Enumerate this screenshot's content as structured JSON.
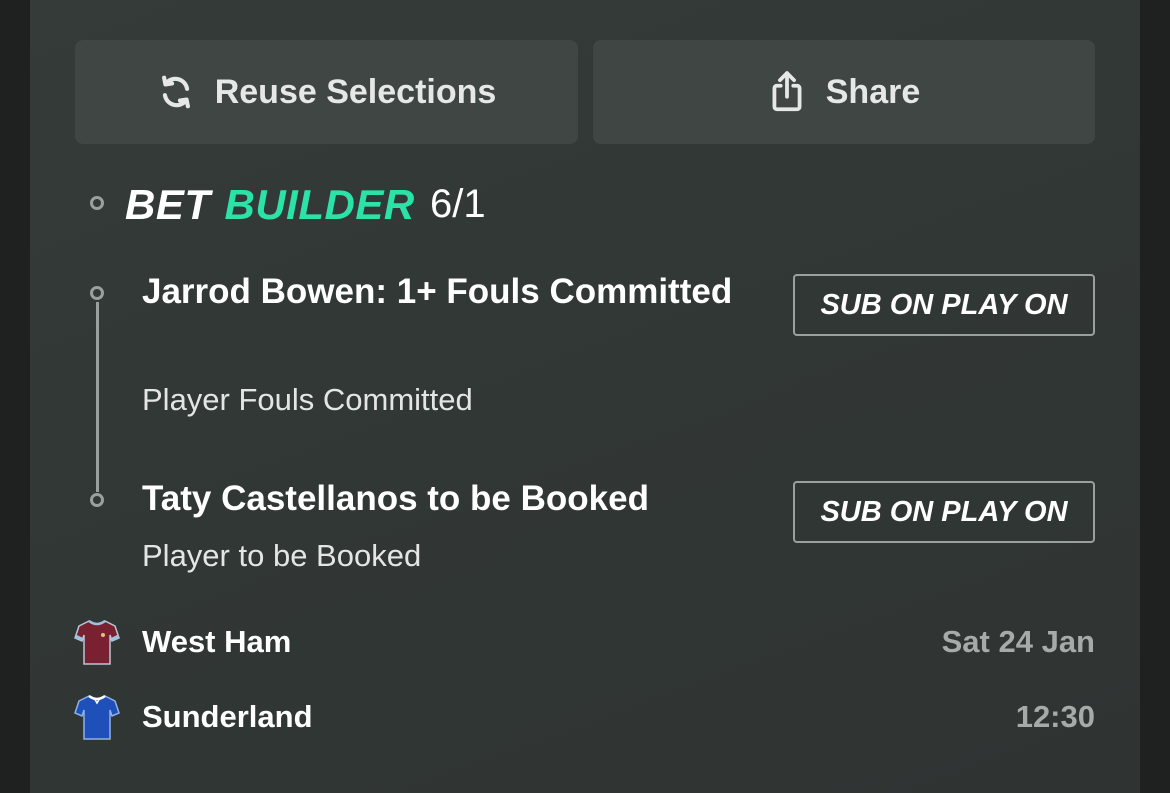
{
  "actions": {
    "reuse_label": "Reuse Selections",
    "share_label": "Share"
  },
  "bet_builder": {
    "label_bet": "BET",
    "label_builder": "BUILDER",
    "odds": "6/1",
    "accent_color": "#2be3a7"
  },
  "selections": [
    {
      "title": "Jarrod Bowen: 1+ Fouls Committed",
      "market": "Player Fouls Committed",
      "badge": "SUB ON PLAY ON"
    },
    {
      "title": "Taty Castellanos to be Booked",
      "market": "Player to be Booked",
      "badge": "SUB ON PLAY ON"
    }
  ],
  "match": {
    "home_team": "West Ham",
    "away_team": "Sunderland",
    "date": "Sat 24 Jan",
    "time": "12:30",
    "home_shirt_color": "#7a2131",
    "away_shirt_color": "#1f4fb8"
  },
  "icons": {
    "reuse": "refresh-icon",
    "share": "share-icon",
    "home_shirt": "shirt-icon",
    "away_shirt": "shirt-icon"
  }
}
